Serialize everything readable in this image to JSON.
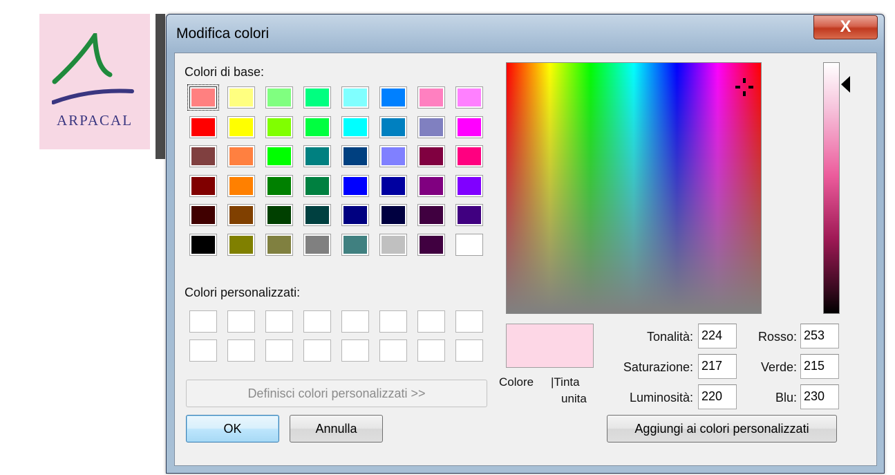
{
  "logo": {
    "text": "ARPACAL"
  },
  "dialog": {
    "title": "Modifica colori",
    "close_symbol": "X"
  },
  "basic_colors": {
    "label": "Colori di base:",
    "rows": [
      [
        "#ff8080",
        "#ffff80",
        "#80ff80",
        "#00ff80",
        "#80ffff",
        "#0080ff",
        "#ff80c0",
        "#ff80ff"
      ],
      [
        "#ff0000",
        "#ffff00",
        "#80ff00",
        "#00ff40",
        "#00ffff",
        "#0080c0",
        "#8080c0",
        "#ff00ff"
      ],
      [
        "#804040",
        "#ff8040",
        "#00ff00",
        "#008080",
        "#004080",
        "#8080ff",
        "#800040",
        "#ff0080"
      ],
      [
        "#800000",
        "#ff8000",
        "#008000",
        "#008040",
        "#0000ff",
        "#0000a0",
        "#800080",
        "#8000ff"
      ],
      [
        "#400000",
        "#804000",
        "#004000",
        "#004040",
        "#000080",
        "#000040",
        "#400040",
        "#400080"
      ],
      [
        "#000000",
        "#808000",
        "#808040",
        "#808080",
        "#408080",
        "#c0c0c0",
        "#400040",
        "#ffffff"
      ]
    ]
  },
  "custom_colors": {
    "label": "Colori personalizzati:",
    "rows": 2,
    "cols": 8
  },
  "buttons": {
    "define_custom": "Definisci colori personalizzati >>",
    "ok": "OK",
    "cancel": "Annulla",
    "add_custom": "Aggiungi ai colori personalizzati"
  },
  "preview": {
    "color": "#fdd7e6",
    "color_label": "Colore",
    "solid_label_line1": "|Tinta",
    "solid_label_line2": "unita"
  },
  "fields": {
    "hue": {
      "label": "Tonalità:",
      "value": "224"
    },
    "saturation": {
      "label": "Saturazione:",
      "value": "217"
    },
    "luminosity": {
      "label": "Luminosità:",
      "value": "220"
    },
    "red": {
      "label": "Rosso:",
      "value": "253"
    },
    "green": {
      "label": "Verde:",
      "value": "215"
    },
    "blue": {
      "label": "Blu:",
      "value": "230"
    }
  }
}
